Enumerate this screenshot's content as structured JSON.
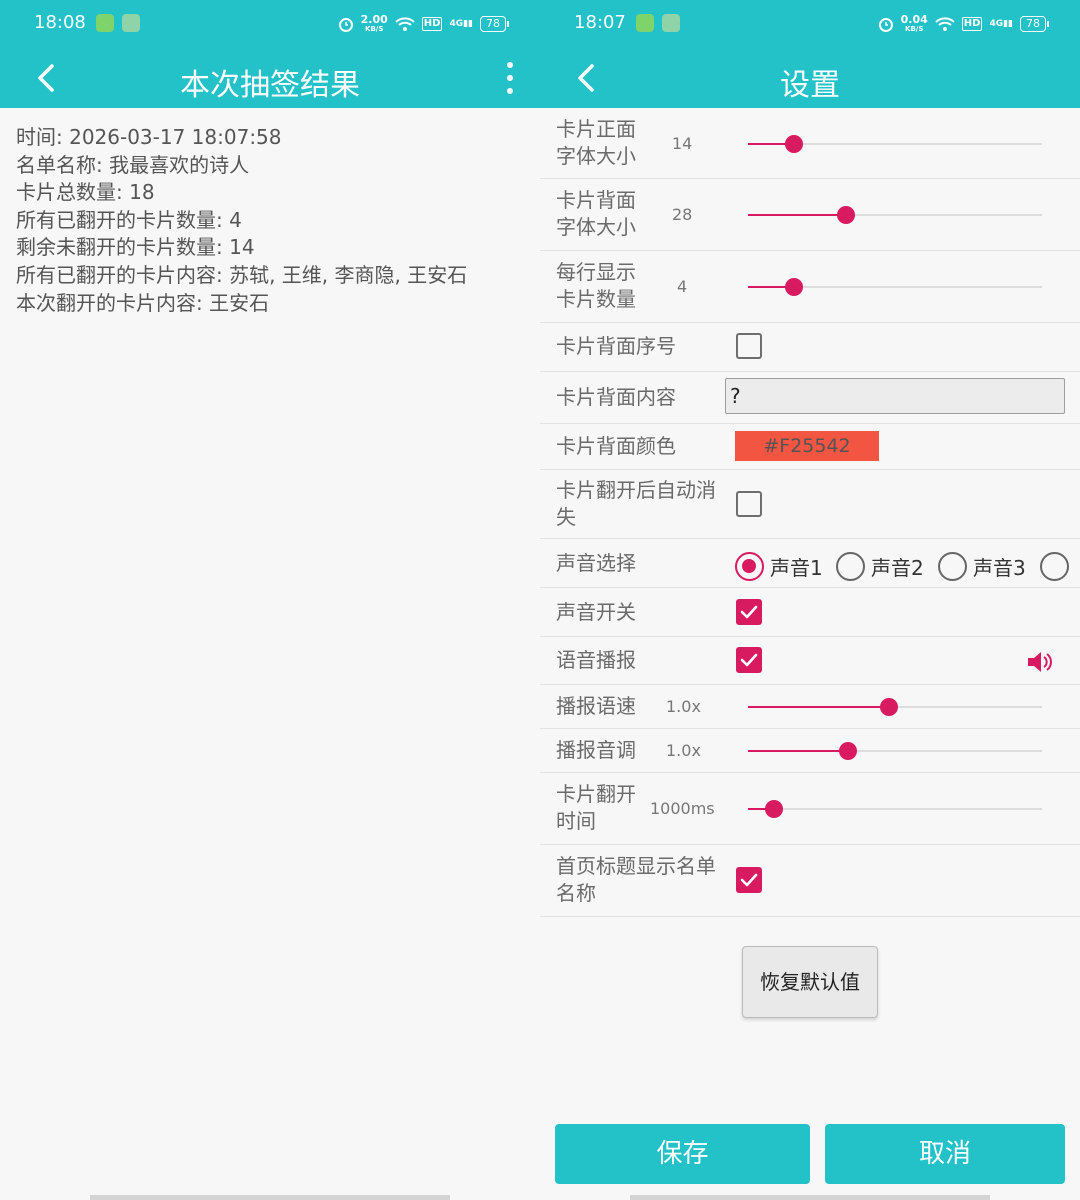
{
  "left": {
    "status": {
      "time": "18:08",
      "speed": "2.00",
      "speed_unit": "KB/S",
      "hd": "HD",
      "net": "4G",
      "battery": "78"
    },
    "header": {
      "title": "本次抽签结果"
    },
    "info": [
      "时间: 2026-03-17 18:07:58",
      "名单名称: 我最喜欢的诗人",
      "卡片总数量: 18",
      "所有已翻开的卡片数量: 4",
      "剩余未翻开的卡片数量: 14",
      "所有已翻开的卡片内容: 苏轼, 王维, 李商隐, 王安石",
      "本次翻开的卡片内容: 王安石"
    ]
  },
  "right": {
    "status": {
      "time": "18:07",
      "speed": "0.04",
      "speed_unit": "KB/S",
      "hd": "HD",
      "net": "4G",
      "battery": "78"
    },
    "header": {
      "title": "设置"
    },
    "settings": {
      "front_font": {
        "label1": "卡片正面",
        "label2": "字体大小",
        "value": "14",
        "level": 0.155
      },
      "back_font": {
        "label1": "卡片背面",
        "label2": "字体大小",
        "value": "28",
        "level": 0.335
      },
      "per_row": {
        "label1": "每行显示",
        "label2": "卡片数量",
        "value": "4",
        "level": 0.155
      },
      "back_index": {
        "label": "卡片背面序号",
        "checked": false
      },
      "back_content": {
        "label": "卡片背面内容",
        "value": "?"
      },
      "back_color": {
        "label": "卡片背面颜色",
        "value": "#F25542",
        "color": "#F25542"
      },
      "auto_hide": {
        "label1": "卡片翻开后自动消",
        "label2": "失",
        "checked": false
      },
      "sound_select": {
        "label": "声音选择",
        "options": [
          "声音1",
          "声音2",
          "声音3"
        ],
        "selected": "声音1"
      },
      "sound_switch": {
        "label": "声音开关",
        "checked": true
      },
      "voice_broadcast": {
        "label": "语音播报",
        "checked": true
      },
      "rate": {
        "label": "播报语速",
        "value": "1.0x",
        "level": 0.48
      },
      "pitch": {
        "label": "播报音调",
        "value": "1.0x",
        "level": 0.34
      },
      "flip_time": {
        "label1": "卡片翻开",
        "label2": "时间",
        "value": "1000ms",
        "level": 0.09
      },
      "show_list_name": {
        "label1": "首页标题显示名单",
        "label2": "名称",
        "checked": true
      }
    },
    "restore_button": "恢复默认值",
    "save_button": "保存",
    "cancel_button": "取消"
  },
  "colors": {
    "primary": "#23c1c8",
    "accent": "#d81b60",
    "swatch": "#F25542"
  }
}
